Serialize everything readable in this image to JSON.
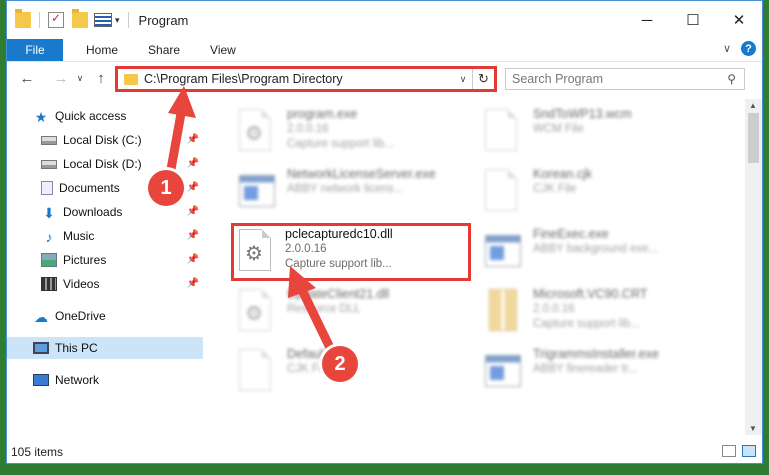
{
  "window": {
    "title": "Program",
    "controls": {
      "minimize": "─",
      "maximize": "☐",
      "close": "✕"
    }
  },
  "ribbon": {
    "tabs": [
      "File",
      "Home",
      "Share",
      "View"
    ],
    "help": "?"
  },
  "nav": {
    "back": "←",
    "forward": "→",
    "dropdown": "∨",
    "up": "↑",
    "address": "C:\\Program Files\\Program Directory",
    "refresh": "↻",
    "search_placeholder": "Search Program"
  },
  "sidebar": {
    "items": [
      {
        "label": "Quick access",
        "icon": "star-icon",
        "pinned": false
      },
      {
        "label": "Local Disk (C:)",
        "icon": "drive-icon",
        "pinned": true
      },
      {
        "label": "Local Disk (D:)",
        "icon": "drive-icon",
        "pinned": true
      },
      {
        "label": "Documents",
        "icon": "documents-icon",
        "pinned": true
      },
      {
        "label": "Downloads",
        "icon": "download-icon",
        "pinned": true
      },
      {
        "label": "Music",
        "icon": "music-icon",
        "pinned": true
      },
      {
        "label": "Pictures",
        "icon": "pictures-icon",
        "pinned": true
      },
      {
        "label": "Videos",
        "icon": "videos-icon",
        "pinned": true
      },
      {
        "label": "OneDrive",
        "icon": "cloud-icon",
        "pinned": false
      },
      {
        "label": "This PC",
        "icon": "computer-icon",
        "pinned": false,
        "selected": true
      },
      {
        "label": "Network",
        "icon": "network-icon",
        "pinned": false
      }
    ]
  },
  "files": [
    {
      "name": "program.exe",
      "line2": "2.0.0.16",
      "line3": "Capture support lib...",
      "icon": "gear-file-icon",
      "blurred": true
    },
    {
      "name": "SndToWP13.wcm",
      "line2": "WCM File",
      "line3": "",
      "icon": "blank-file-icon",
      "blurred": true
    },
    {
      "name": "NetworkLicenseServer.exe",
      "line2": "ABBY network licens...",
      "line3": "",
      "icon": "app-icon",
      "blurred": true
    },
    {
      "name": "Korean.cjk",
      "line2": "CJK File",
      "line3": "",
      "icon": "blank-file-icon",
      "blurred": true
    },
    {
      "name": "pclecapturedc10.dll",
      "line2": "2.0.0.16",
      "line3": "Capture support lib...",
      "icon": "gear-file-icon",
      "blurred": false,
      "highlighted": true
    },
    {
      "name": "FineExec.exe",
      "line2": "ABBY background exe...",
      "line3": "",
      "icon": "app-icon",
      "blurred": true
    },
    {
      "name": "UpdateClient21.dll",
      "line2": "Resource DLL",
      "line3": "",
      "icon": "gear-file-icon",
      "blurred": true
    },
    {
      "name": "Microsoft.VC90.CRT",
      "line2": "2.0.0.16",
      "line3": "Capture support lib...",
      "icon": "zip-icon",
      "blurred": true
    },
    {
      "name": "Default.cjk",
      "line2": "CJK File",
      "line3": "",
      "icon": "blank-file-icon",
      "blurred": true
    },
    {
      "name": "TrigrammsInstaller.exe",
      "line2": "ABBY finereader tr...",
      "line3": "",
      "icon": "app-icon",
      "blurred": true
    }
  ],
  "status": {
    "item_count": "105 items"
  },
  "annotations": {
    "marker1": "1",
    "marker2": "2",
    "color": "#e8453c"
  },
  "colors": {
    "accent": "#1979ca",
    "highlight_border": "#e53935",
    "selected_bg": "#cce4f7"
  }
}
